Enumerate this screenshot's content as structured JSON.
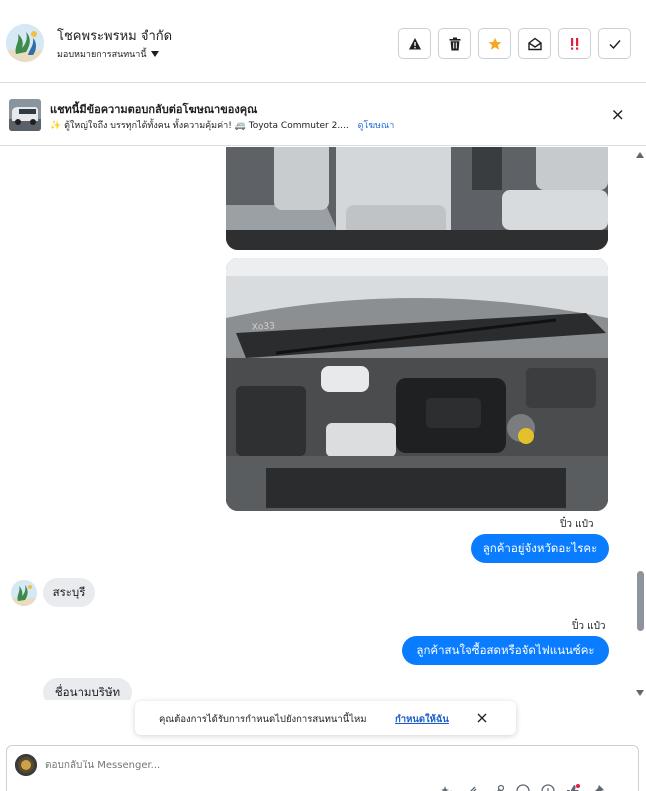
{
  "header": {
    "page_name": "โชคพระพรหม จำกัด",
    "assign_label": "มอบหมายการสนทนานี้",
    "actions": [
      {
        "name": "report-icon"
      },
      {
        "name": "trash-icon"
      },
      {
        "name": "star-icon"
      },
      {
        "name": "mark-unread-icon"
      },
      {
        "name": "priority-icon"
      },
      {
        "name": "check-icon"
      }
    ]
  },
  "ad_banner": {
    "title": "แชทนี้มีข้อความตอบกลับต่อโฆษณาของคุณ",
    "subtitle": "✨ ตู้ใหญ่ใจถึง บรรทุกได้ทั้งคน ทั้งความคุ้มค่า! 🚐 Toyota Commuter 2....",
    "view_ad_link": "ดูโฆษณา"
  },
  "messages": [
    {
      "sender": "ปิ๋ว แป๋ว",
      "text": "ลูกค้าอยู่จังหวัดอะไรคะ"
    },
    {
      "text": "สระบุรี"
    },
    {
      "sender": "ปิ๋ว แป๋ว",
      "text": "ลูกค้าสนใจซื้อสดหรือจัดไฟแนนซ์คะ"
    },
    {
      "text": "ชื่อนามบริษัท"
    }
  ],
  "toast": {
    "text": "คุณต้องการได้รับการกำหนดไปยังการสนทนานี้ไหม",
    "link": "กำหนดให้ฉัน"
  },
  "composer": {
    "placeholder": "ตอบกลับใน Messenger..."
  },
  "colors": {
    "outgoing_bubble": "#0a7cff",
    "incoming_bubble": "#e9ebee",
    "star": "#f5a623",
    "priority": "#e41e3f",
    "link": "#216fdb"
  }
}
